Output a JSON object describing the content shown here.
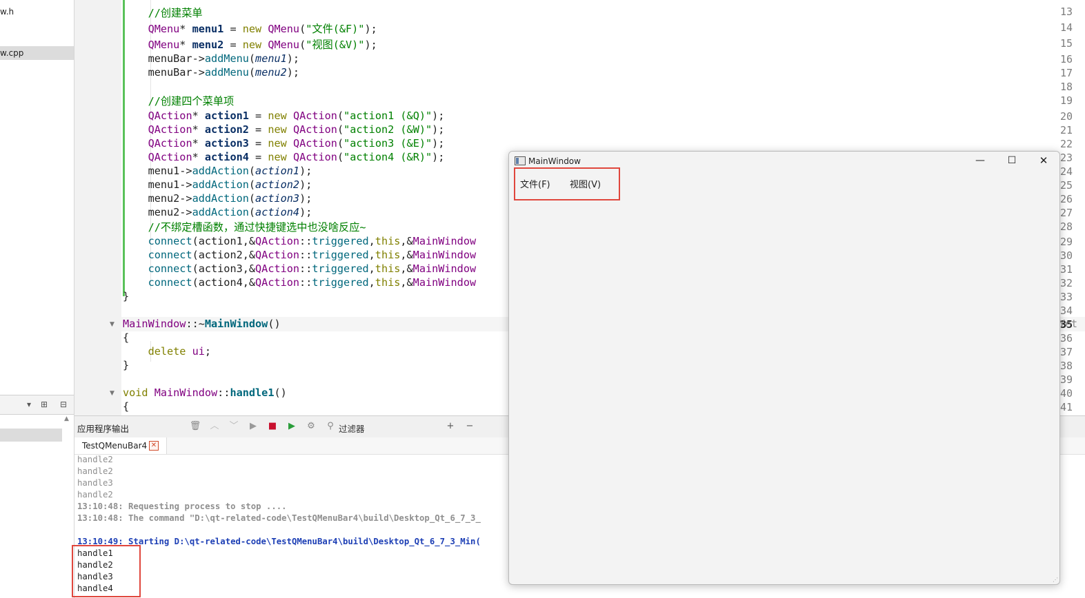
{
  "project_tree": {
    "files": [
      "w.h",
      "w.cpp"
    ]
  },
  "editor": {
    "line_numbers": [
      "13",
      "14",
      "15",
      "16",
      "17",
      "18",
      "19",
      "20",
      "21",
      "22",
      "23",
      "24",
      "25",
      "26",
      "27",
      "28",
      "29",
      "30",
      "31",
      "32",
      "33",
      "34",
      "35",
      "36",
      "37",
      "38",
      "39",
      "40",
      "41"
    ],
    "current_line": "35",
    "overflow_text": "Yet"
  },
  "output": {
    "pane_title": "应用程序输出",
    "filter_label": "过滤器",
    "tab_label": "TestQMenuBar4",
    "lines": [
      "handle2",
      "handle2",
      "handle3",
      "handle2",
      "13:10:48: Requesting process to stop ....",
      "13:10:48: The command \"D:\\qt-related-code\\TestQMenuBar4\\build\\Desktop_Qt_6_7_3_",
      "",
      "13:10:49: Starting D:\\qt-related-code\\TestQMenuBar4\\build\\Desktop_Qt_6_7_3_Min(",
      "handle1",
      "handle2",
      "handle3",
      "handle4"
    ]
  },
  "main_window": {
    "title": "MainWindow",
    "menus": [
      "文件(F)",
      "视图(V)"
    ]
  },
  "colors": {
    "highlight_box": "#e0463c",
    "keyword": "#808000",
    "type": "#800080",
    "string": "#008000",
    "function": "#00677c",
    "console_blue": "#1d3fb5"
  }
}
